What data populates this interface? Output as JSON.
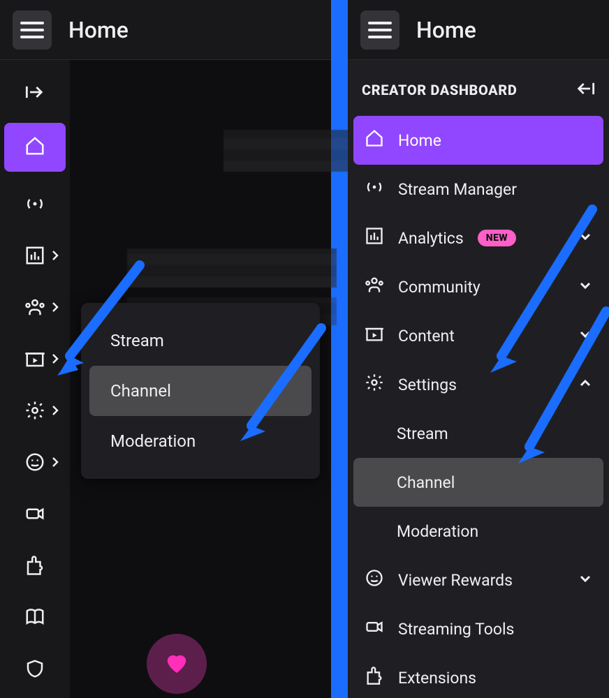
{
  "left": {
    "title": "Home",
    "rail_popout": {
      "items": [
        "Stream",
        "Channel",
        "Moderation"
      ],
      "highlight_index": 1
    }
  },
  "right": {
    "title": "Home",
    "sidebar_title": "CREATOR DASHBOARD",
    "nav": {
      "home": "Home",
      "stream_manager": "Stream Manager",
      "analytics": "Analytics",
      "analytics_badge": "NEW",
      "community": "Community",
      "content": "Content",
      "settings": "Settings",
      "settings_children": [
        "Stream",
        "Channel",
        "Moderation"
      ],
      "settings_highlight_index": 1,
      "viewer_rewards": "Viewer Rewards",
      "streaming_tools": "Streaming Tools",
      "extensions": "Extensions"
    }
  }
}
